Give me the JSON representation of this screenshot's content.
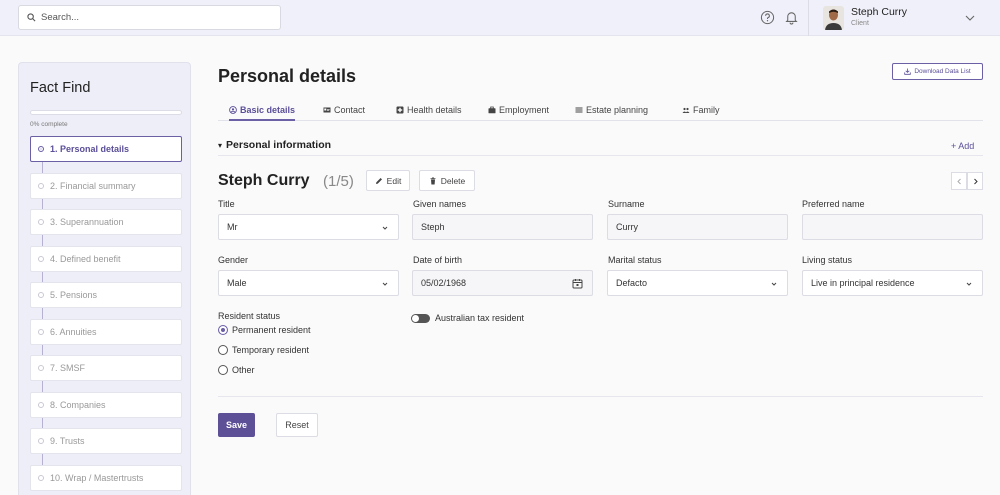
{
  "search": {
    "placeholder": "Search..."
  },
  "user": {
    "name": "Steph Curry",
    "role": "Client"
  },
  "sidebar": {
    "title": "Fact Find",
    "progress_text": "0% complete",
    "progress_value": 0,
    "steps": [
      {
        "label": "1. Personal details",
        "active": true
      },
      {
        "label": "2. Financial summary"
      },
      {
        "label": "3. Superannuation"
      },
      {
        "label": "4. Defined benefit"
      },
      {
        "label": "5. Pensions"
      },
      {
        "label": "6. Annuities"
      },
      {
        "label": "7. SMSF"
      },
      {
        "label": "8. Companies"
      },
      {
        "label": "9. Trusts"
      },
      {
        "label": "10. Wrap / Mastertrusts"
      }
    ]
  },
  "main": {
    "title": "Personal details",
    "download_label": "Download Data List",
    "tabs": [
      {
        "label": "Basic details",
        "icon": "user-circle-icon",
        "active": true
      },
      {
        "label": "Contact",
        "icon": "id-card-icon"
      },
      {
        "label": "Health details",
        "icon": "medical-cross-icon"
      },
      {
        "label": "Employment",
        "icon": "briefcase-icon"
      },
      {
        "label": "Estate planning",
        "icon": "list-icon"
      },
      {
        "label": "Family",
        "icon": "people-icon"
      }
    ],
    "section_title": "Personal information",
    "add_label": "+ Add",
    "person_name": "Steph Curry",
    "person_count": "(1/5)",
    "edit_label": "Edit",
    "delete_label": "Delete",
    "fields": {
      "title": {
        "label": "Title",
        "value": "Mr"
      },
      "given_names": {
        "label": "Given names",
        "value": "Steph"
      },
      "surname": {
        "label": "Surname",
        "value": "Curry"
      },
      "preferred_name": {
        "label": "Preferred name",
        "value": ""
      },
      "gender": {
        "label": "Gender",
        "value": "Male"
      },
      "dob": {
        "label": "Date of birth",
        "value": "05/02/1968"
      },
      "marital": {
        "label": "Marital status",
        "value": "Defacto"
      },
      "living": {
        "label": "Living status",
        "value": "Live in principal residence"
      }
    },
    "resident_status": {
      "label": "Resident status",
      "options": [
        "Permanent resident",
        "Temporary resident",
        "Other"
      ],
      "selected": "Permanent resident"
    },
    "tax_resident_label": "Australian tax resident",
    "tax_resident_on": false,
    "save_label": "Save",
    "reset_label": "Reset"
  },
  "colors": {
    "accent": "#6b5fa6",
    "accent_dark": "#5d5096"
  }
}
